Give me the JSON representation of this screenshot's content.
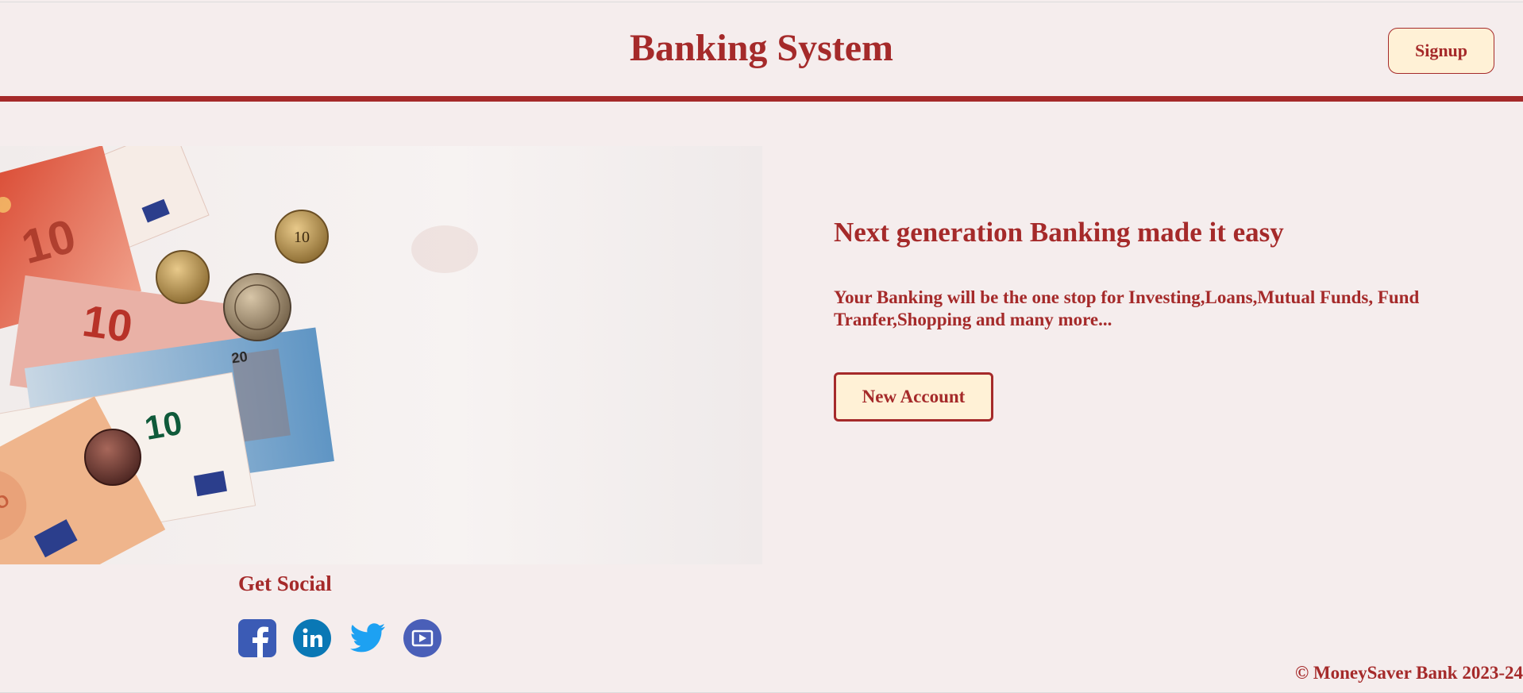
{
  "header": {
    "title": "Banking System",
    "signup_label": "Signup"
  },
  "hero": {
    "headline": "Next generation Banking made it easy",
    "subtext": "Your Banking will be the one stop for Investing,Loans,Mutual Funds, Fund Tranfer,Shopping and many more...",
    "cta_label": "New Account",
    "image_subject": "euro banknotes and coins on white surface"
  },
  "social": {
    "title": "Get Social",
    "icons": [
      "facebook-icon",
      "linkedin-icon",
      "twitter-icon",
      "video-icon"
    ]
  },
  "footer": {
    "copyright": "© MoneySaver Bank 2023-24"
  },
  "colors": {
    "accent": "#a52a2a",
    "background": "#f5eded",
    "button_fill": "#fff1d6"
  }
}
